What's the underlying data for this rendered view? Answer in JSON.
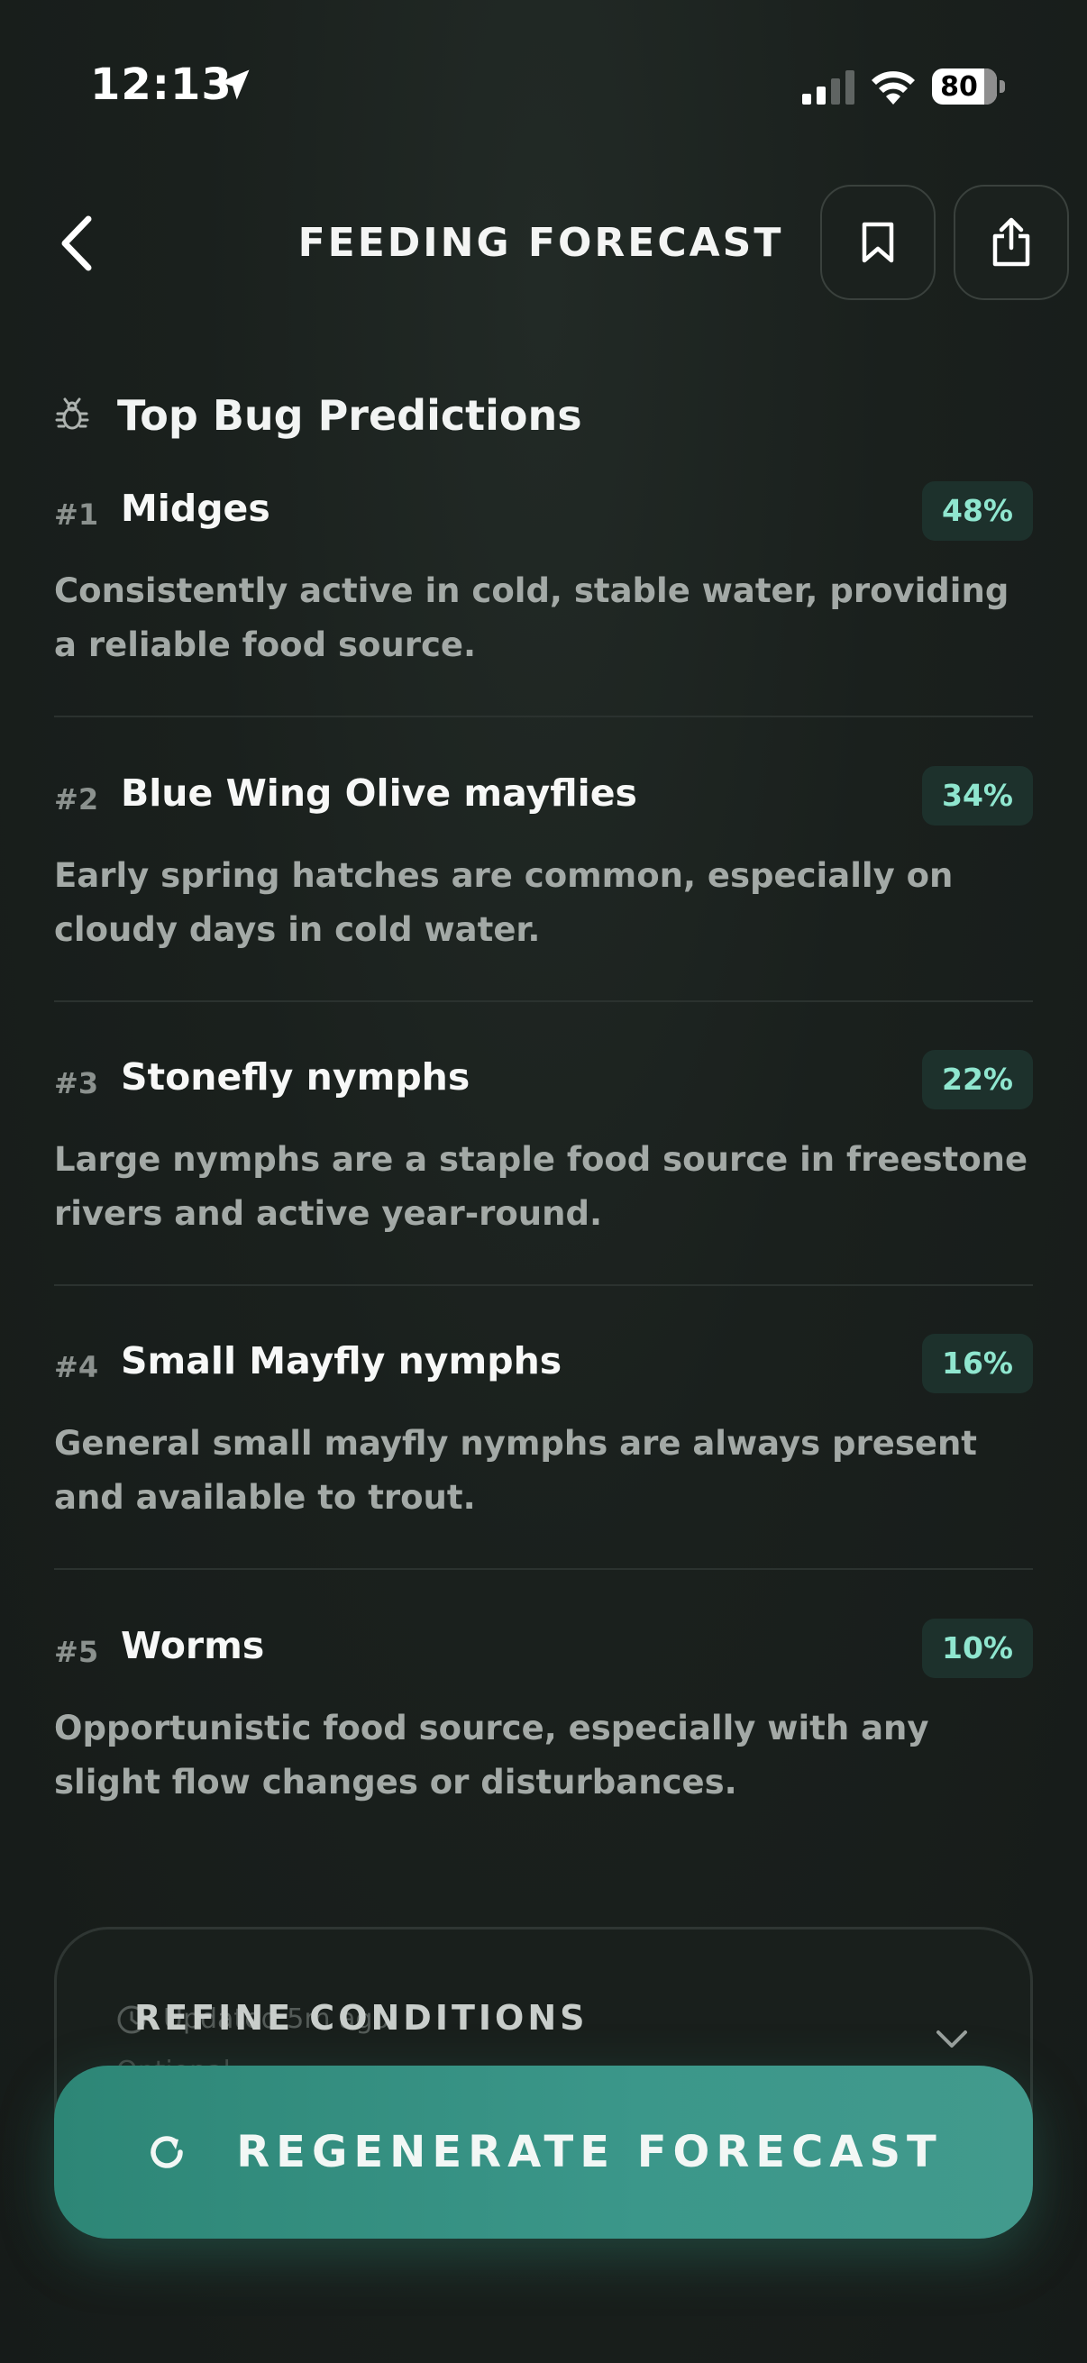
{
  "status_bar": {
    "time": "12:13",
    "battery": "80"
  },
  "header": {
    "title": "FEEDING FORECAST"
  },
  "section": {
    "title": "Top Bug Predictions"
  },
  "predictions": [
    {
      "rank": "#1",
      "name": "Midges",
      "percent": "48%",
      "description": "Consistently active in cold, stable water, providing a reliable food source."
    },
    {
      "rank": "#2",
      "name": "Blue Wing Olive mayflies",
      "percent": "34%",
      "description": "Early spring hatches are common, especially on cloudy days in cold water."
    },
    {
      "rank": "#3",
      "name": "Stonefly nymphs",
      "percent": "22%",
      "description": "Large nymphs are a staple food source in freestone rivers and active year-round."
    },
    {
      "rank": "#4",
      "name": "Small Mayfly nymphs",
      "percent": "16%",
      "description": "General small mayfly nymphs are always present and available to trout."
    },
    {
      "rank": "#5",
      "name": "Worms",
      "percent": "10%",
      "description": "Opportunistic food source, especially with any slight flow changes or disturbances."
    }
  ],
  "refine": {
    "title": "REFINE CONDITIONS",
    "updated": "Updated 5m ago",
    "subtitle": "Optional …"
  },
  "regenerate_button": {
    "label": "REGENERATE FORECAST"
  },
  "colors": {
    "accent": "#3b978a",
    "badge_text": "#8fe6cf",
    "background": "#1a201d"
  }
}
